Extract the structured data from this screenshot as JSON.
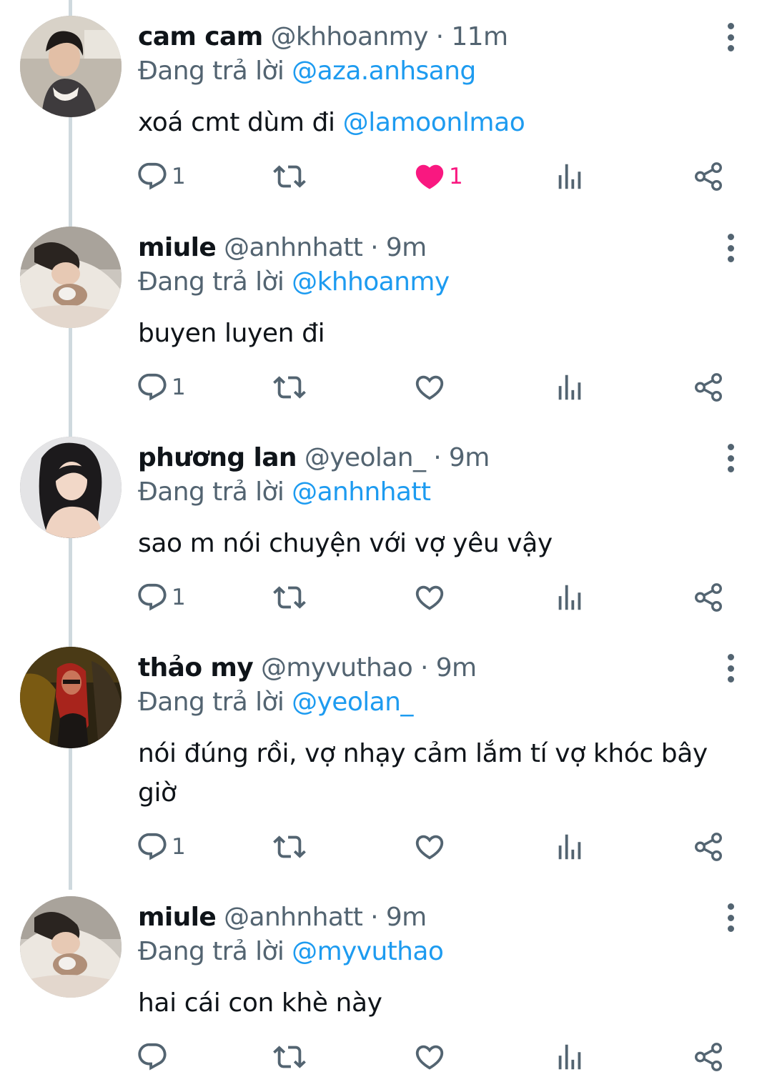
{
  "reply_prefix": "Đang trả lời",
  "colors": {
    "accent": "#1d9bf0",
    "text_primary": "#0f1419",
    "text_secondary": "#536471",
    "like_active": "#f91880",
    "thread_line": "#cfd9de"
  },
  "tweets": [
    {
      "display_name": "cam cam",
      "handle": "@khhoanmy",
      "separator": "·",
      "time": "11m",
      "replying_to": "@aza.anhsang",
      "text_plain": "xoá cmt dùm đi ",
      "text_mention": "@lamoonlmao",
      "reply_count": "1",
      "retweet_count": "",
      "like_count": "1",
      "liked": true,
      "avatar_icon": "avatar-photo"
    },
    {
      "display_name": "miule",
      "handle": "@anhnhatt",
      "separator": "·",
      "time": "9m",
      "replying_to": "@khhoanmy",
      "text_plain": "buyen luyen đi",
      "text_mention": "",
      "reply_count": "1",
      "retweet_count": "",
      "like_count": "",
      "liked": false,
      "avatar_icon": "avatar-photo"
    },
    {
      "display_name": "phương lan",
      "handle": "@yeolan_",
      "separator": "·",
      "time": "9m",
      "replying_to": "@anhnhatt",
      "text_plain": "sao m nói chuyện với vợ yêu vậy",
      "text_mention": "",
      "reply_count": "1",
      "retweet_count": "",
      "like_count": "",
      "liked": false,
      "avatar_icon": "avatar-photo"
    },
    {
      "display_name": "thảo my",
      "handle": "@myvuthao",
      "separator": "·",
      "time": "9m",
      "replying_to": "@yeolan_",
      "text_plain": "nói đúng rồi, vợ nhạy cảm lắm tí vợ khóc bây giờ",
      "text_mention": "",
      "reply_count": "1",
      "retweet_count": "",
      "like_count": "",
      "liked": false,
      "avatar_icon": "avatar-photo"
    },
    {
      "display_name": "miule",
      "handle": "@anhnhatt",
      "separator": "·",
      "time": "9m",
      "replying_to": "@myvuthao",
      "text_plain": "hai cái con khè này",
      "text_mention": "",
      "reply_count": "",
      "retweet_count": "",
      "like_count": "",
      "liked": false,
      "avatar_icon": "avatar-photo"
    }
  ]
}
